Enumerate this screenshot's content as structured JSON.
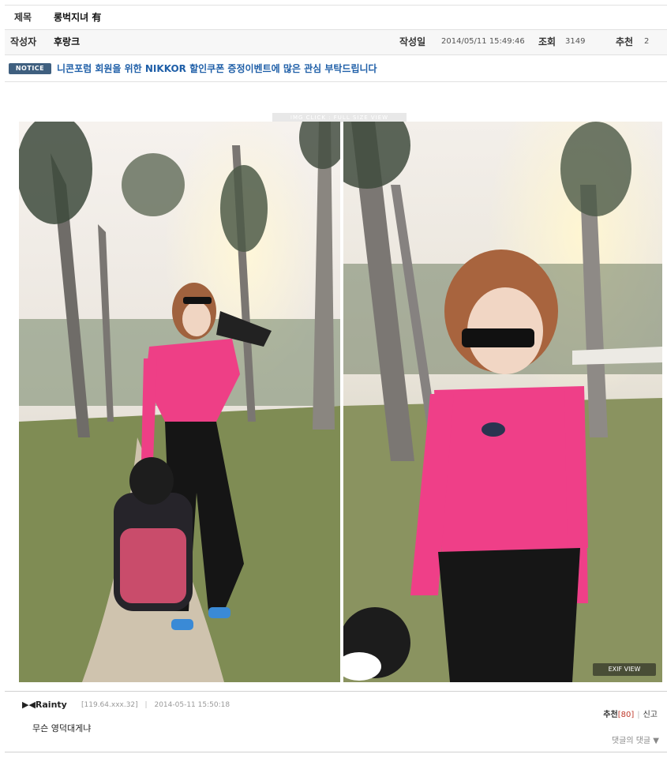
{
  "post": {
    "title_label": "제목",
    "title": "롱벅지녀 有",
    "author_label": "작성자",
    "author": "후랑크",
    "date_label": "작성일",
    "date": "2014/05/11 15:49:46",
    "views_label": "조회",
    "views": "3149",
    "recommend_label": "추천",
    "recommend": "2"
  },
  "notice": {
    "badge": "NOTICE",
    "text": "니콘포럼 회원을 위한 NIKKOR 할인쿠폰 증정이벤트에 많은 관심 부탁드립니다"
  },
  "image": {
    "hint": "IMG CLICK : FULL SIZE VIEW",
    "exif": "EXIF VIEW"
  },
  "comment": {
    "author": "▶◀Rainty",
    "ip": "[119.64.xxx.32]",
    "sep": "|",
    "date": "2014-05-11 15:50:18",
    "body": "무슨 영덕대게냐",
    "recommend_label": "추천",
    "recommend_count": "[80]",
    "report_label": "신고",
    "reply_label": "댓글의 댓글 ▼"
  }
}
